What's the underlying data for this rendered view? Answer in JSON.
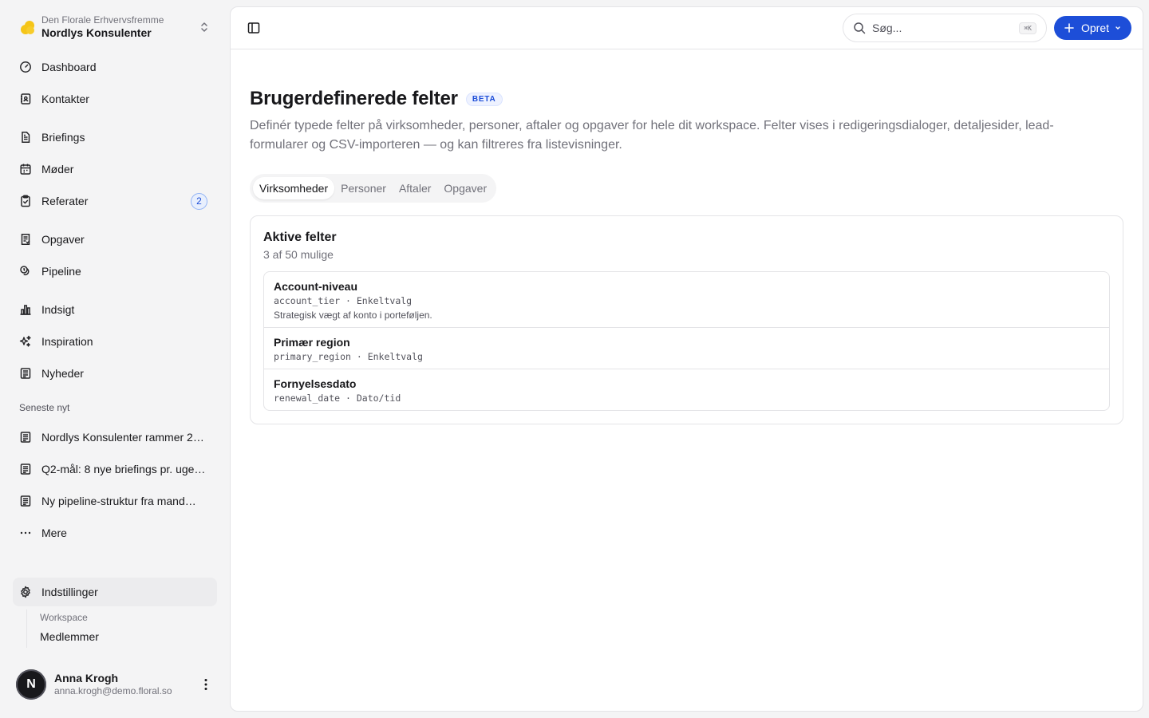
{
  "workspace": {
    "org": "Den Florale Erhvervsfremme",
    "name": "Nordlys Konsulenter"
  },
  "nav": {
    "dashboard": "Dashboard",
    "kontakter": "Kontakter",
    "briefings": "Briefings",
    "moder": "Møder",
    "referater": "Referater",
    "referater_count": "2",
    "opgaver": "Opgaver",
    "pipeline": "Pipeline",
    "indsigt": "Indsigt",
    "inspiration": "Inspiration",
    "nyheder": "Nyheder"
  },
  "news": {
    "label": "Seneste nyt",
    "items": [
      "Nordlys Konsulenter rammer 2…",
      "Q2-mål: 8 nye briefings pr. uge…",
      "Ny pipeline-struktur fra mand…"
    ],
    "more": "Mere"
  },
  "settings": {
    "label": "Indstillinger",
    "group": "Workspace",
    "members": "Medlemmer"
  },
  "user": {
    "initial": "N",
    "name": "Anna Krogh",
    "email": "anna.krogh@demo.floral.so"
  },
  "topbar": {
    "search_placeholder": "Søg...",
    "shortcut": "⌘K",
    "create_label": "Opret"
  },
  "page": {
    "title": "Brugerdefinerede felter",
    "badge": "BETA",
    "description": "Definér typede felter på virksomheder, personer, aftaler og opgaver for hele dit workspace. Felter vises i redigeringsdialoger, detaljesider, lead-formularer og CSV-importeren — og kan filtreres fra listevisninger."
  },
  "tabs": [
    "Virksomheder",
    "Personer",
    "Aftaler",
    "Opgaver"
  ],
  "active_fields": {
    "title": "Aktive felter",
    "subtitle": "3 af 50 mulige",
    "fields": [
      {
        "name": "Account-niveau",
        "meta": "account_tier · Enkeltvalg",
        "description": "Strategisk vægt af konto i porteføljen."
      },
      {
        "name": "Primær region",
        "meta": "primary_region · Enkeltvalg"
      },
      {
        "name": "Fornyelsesdato",
        "meta": "renewal_date · Dato/tid"
      }
    ]
  },
  "colors": {
    "accent": "#1d4ed8",
    "logo": "#f5c518"
  }
}
